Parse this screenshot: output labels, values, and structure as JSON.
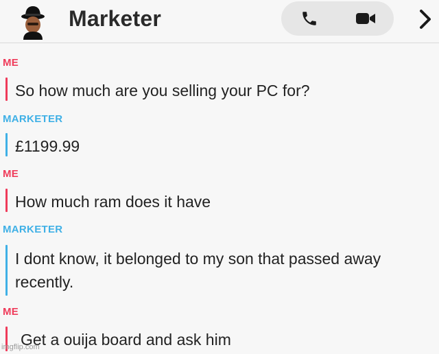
{
  "header": {
    "title": "Marketer",
    "avatar_icon": "user-avatar-fedora-icon",
    "phone_icon": "phone-icon",
    "video_icon": "video-camera-icon",
    "more_icon": "chevron-right-icon"
  },
  "colors": {
    "me": "#ef3b5a",
    "them": "#3fb0e6",
    "background": "#f7f7f7"
  },
  "messages": [
    {
      "sender": "ME",
      "text": "So how much are you selling your PC for?"
    },
    {
      "sender": "MARKETER",
      "text": "£1199.99"
    },
    {
      "sender": "ME",
      "text": "How much ram does it have"
    },
    {
      "sender": "MARKETER",
      "text": "I dont know, it belonged to my son that passed away recently."
    },
    {
      "sender": "ME",
      "text": "Get a ouija board and ask him"
    }
  ],
  "watermark": "imgflip.com"
}
